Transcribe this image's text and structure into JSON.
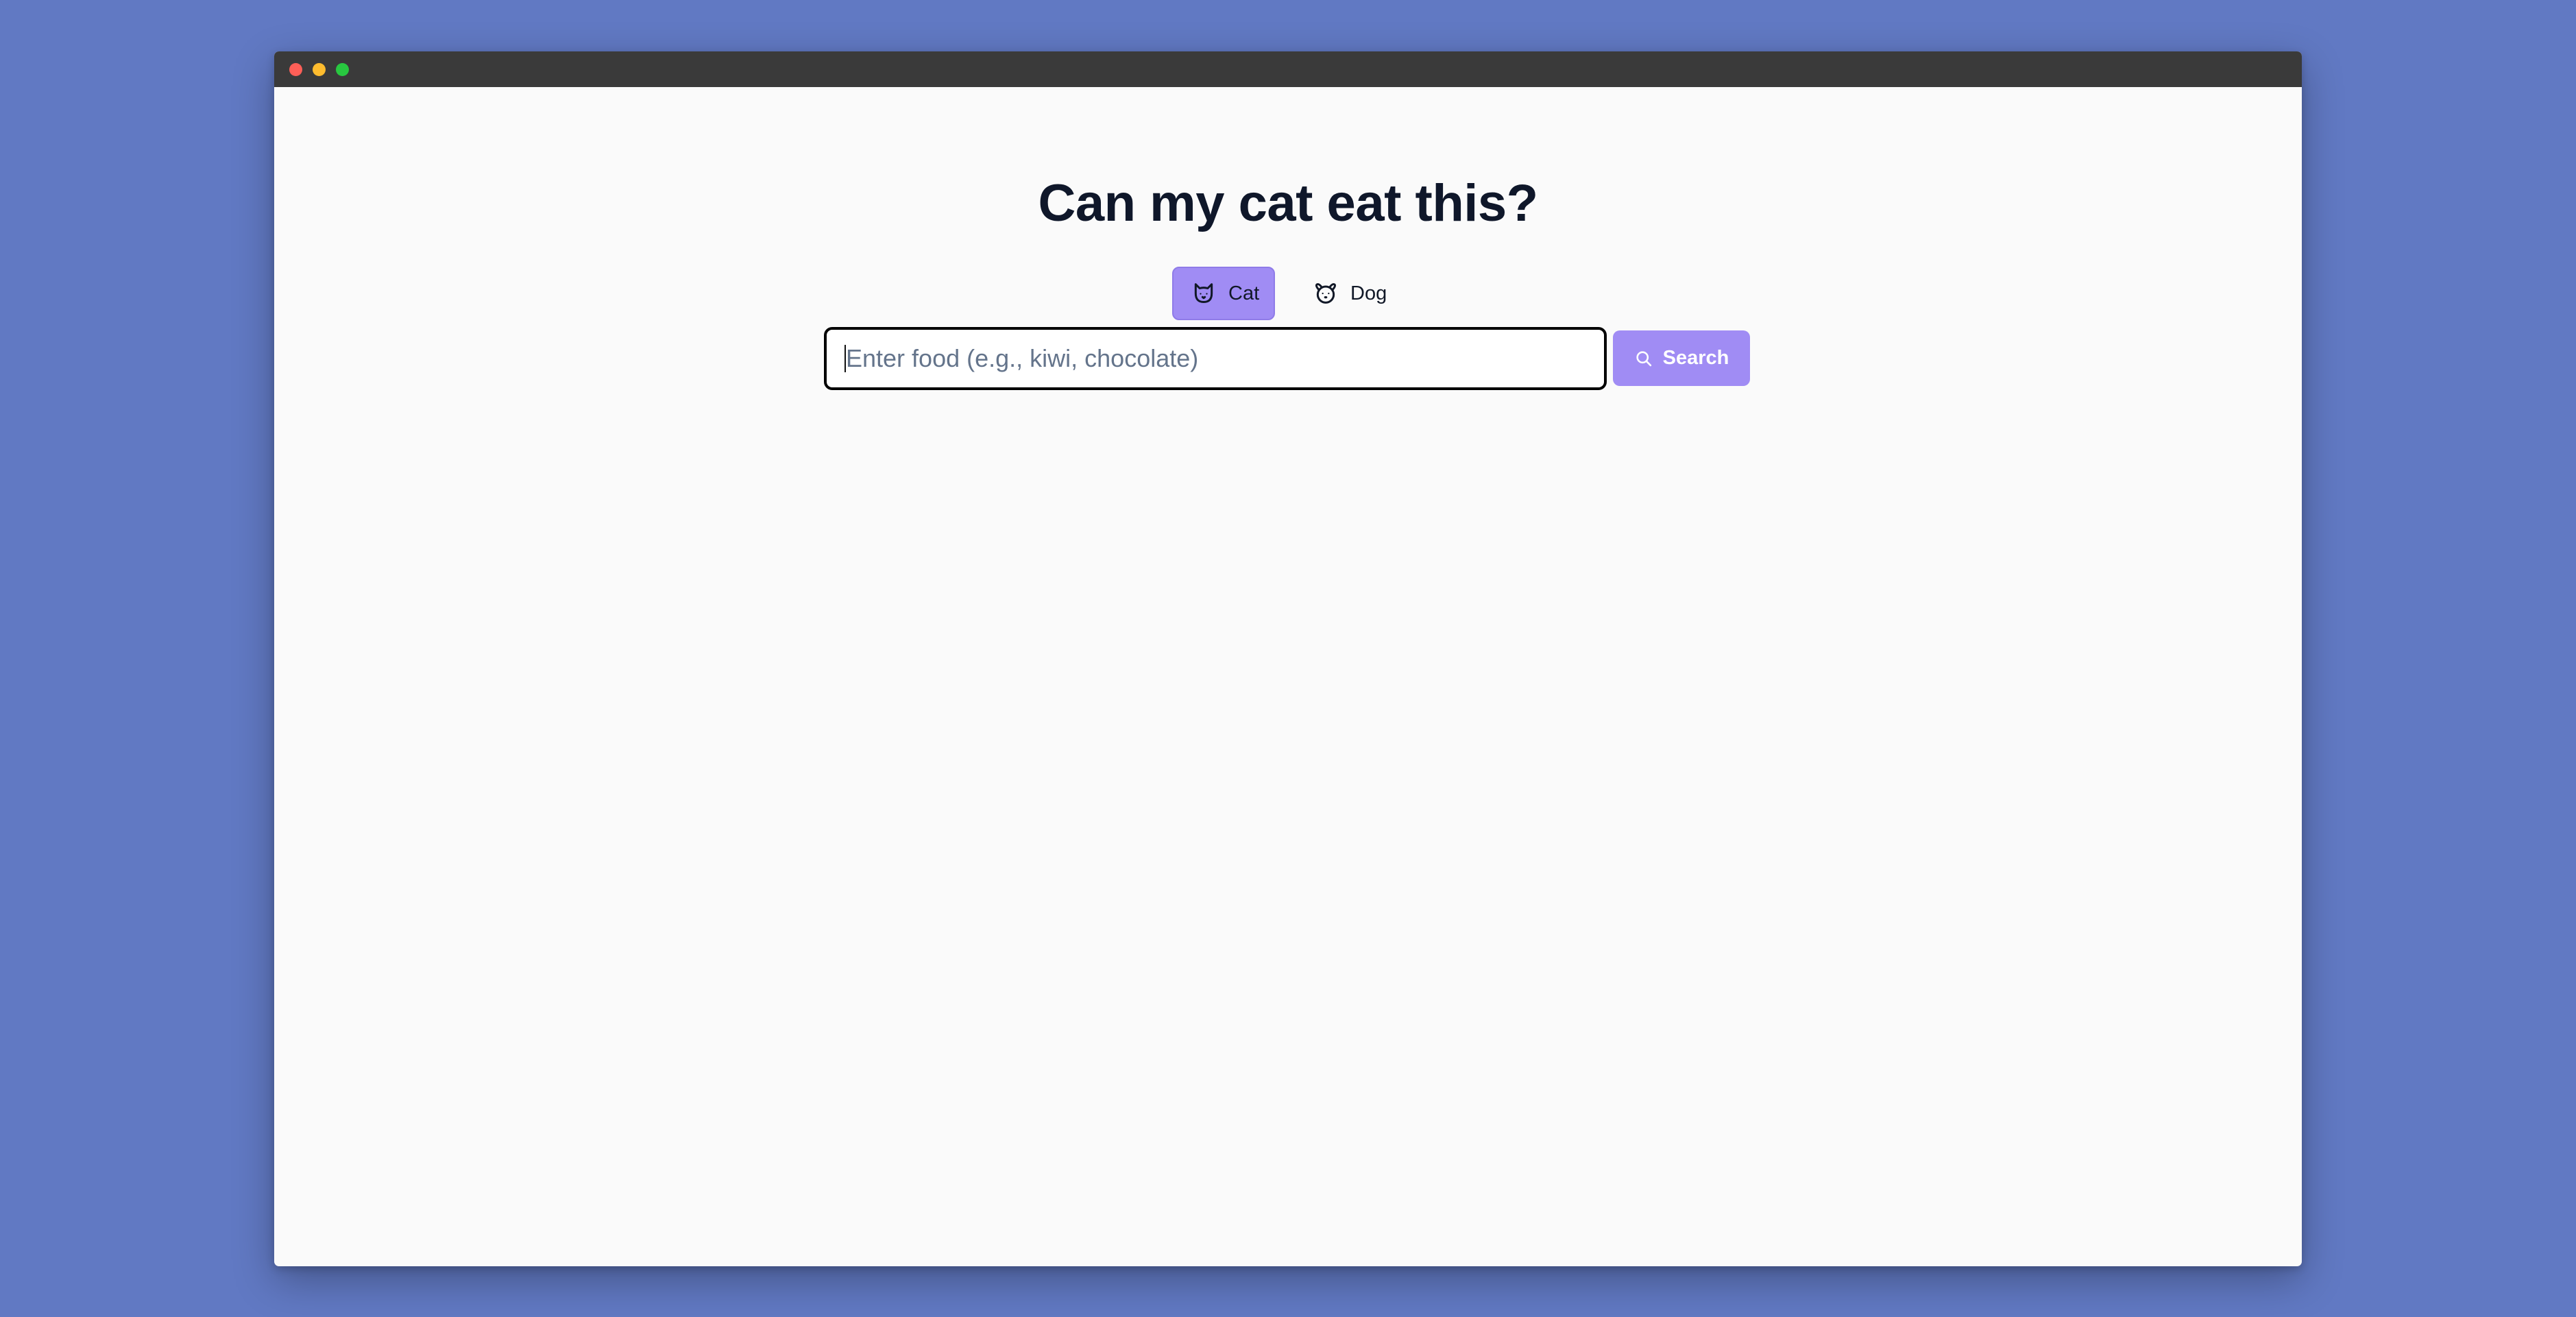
{
  "window": {
    "controls": [
      "close",
      "minimize",
      "maximize"
    ]
  },
  "page": {
    "title": "Can my cat eat this?"
  },
  "pet_selector": {
    "selected": "cat",
    "options": [
      {
        "id": "cat",
        "label": "Cat",
        "icon": "cat-icon",
        "active": true
      },
      {
        "id": "dog",
        "label": "Dog",
        "icon": "dog-icon",
        "active": false
      }
    ]
  },
  "search": {
    "placeholder": "Enter food (e.g., kiwi, chocolate)",
    "value": "",
    "button_label": "Search",
    "button_icon": "search-icon"
  },
  "colors": {
    "desktop_background": "#6179c3",
    "accent": "#a08cf4",
    "title_text": "#0f172a",
    "titlebar": "#3a3a3a"
  }
}
